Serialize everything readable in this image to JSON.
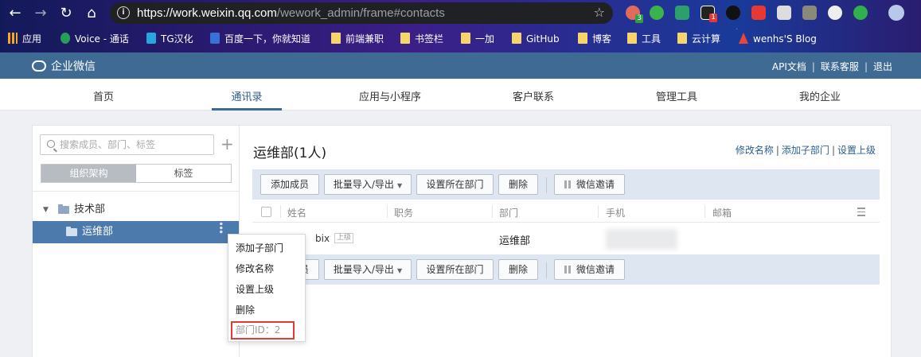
{
  "browser": {
    "url_host": "https://work.weixin.qq.com",
    "url_path": "/wework_admin/frame#contacts",
    "ext_badges": [
      "3",
      "1"
    ]
  },
  "bookmarks": [
    "应用",
    "Voice - 通话",
    "TG汉化",
    "百度一下，你就知道",
    "前端兼职",
    "书签栏",
    "一加",
    "GitHub",
    "博客",
    "工具",
    "云计算",
    "wenhs'S Blog"
  ],
  "header": {
    "logo": "企业微信",
    "links": [
      "API文档",
      "联系客服",
      "退出"
    ]
  },
  "mainnav": {
    "tabs": [
      "首页",
      "通讯录",
      "应用与小程序",
      "客户联系",
      "管理工具",
      "我的企业"
    ],
    "active": "通讯录"
  },
  "left": {
    "search_placeholder": "搜索成员、部门、标签",
    "seg": [
      "组织架构",
      "标签"
    ],
    "tree": [
      {
        "label": "技术部"
      },
      {
        "label": "运维部"
      }
    ]
  },
  "context_menu": {
    "items": [
      "添加子部门",
      "修改名称",
      "设置上级",
      "删除"
    ],
    "dept_id": "部门ID：2"
  },
  "right": {
    "title": "运维部(1人)",
    "links": [
      "修改名称",
      "添加子部门",
      "设置上级"
    ],
    "toolbar": {
      "add_member": "添加成员",
      "batch": "批量导入/导出",
      "set_dept": "设置所在部门",
      "delete": "删除",
      "wx_invite": "微信邀请"
    },
    "columns": [
      "姓名",
      "职务",
      "部门",
      "手机",
      "邮箱"
    ],
    "rows": [
      {
        "name": "bix",
        "tag": "上级",
        "dept": "运维部"
      }
    ]
  }
}
